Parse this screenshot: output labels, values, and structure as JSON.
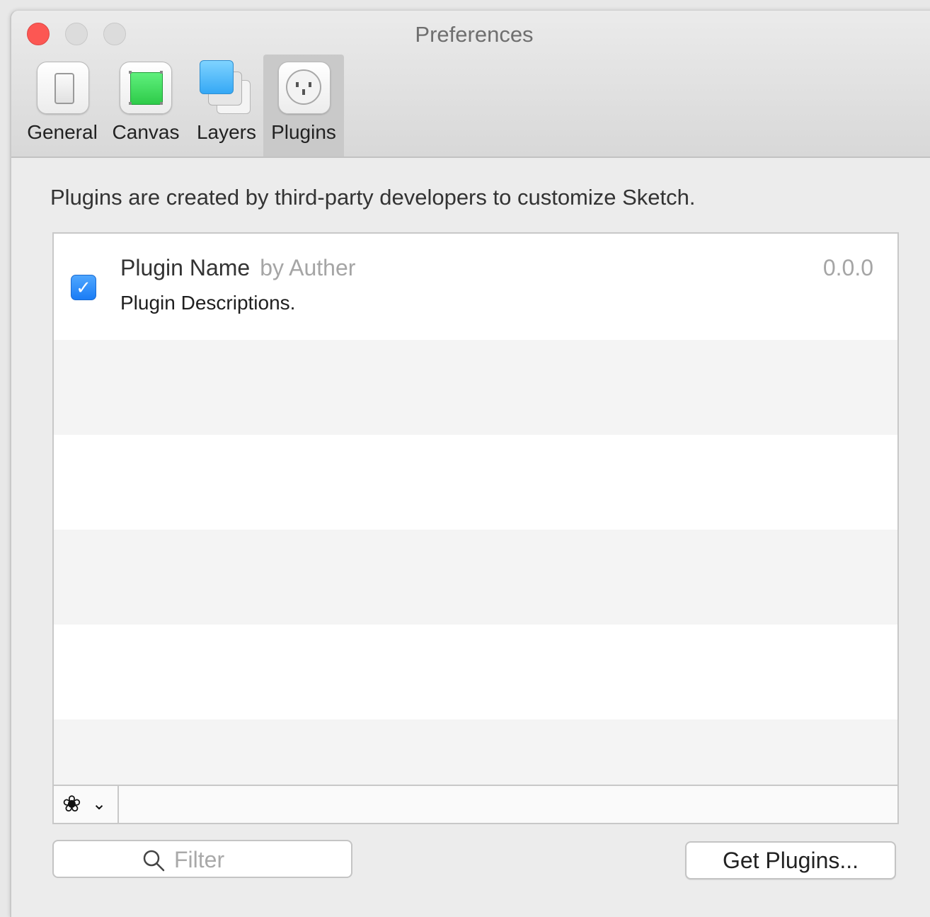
{
  "window": {
    "title": "Preferences"
  },
  "tabs": [
    {
      "label": "General",
      "icon": "general-switch-icon"
    },
    {
      "label": "Canvas",
      "icon": "canvas-square-icon"
    },
    {
      "label": "Layers",
      "icon": "layers-icon"
    },
    {
      "label": "Plugins",
      "icon": "plugin-socket-icon",
      "selected": true
    }
  ],
  "plugins_pane": {
    "intro": "Plugins are created by third-party developers to customize Sketch.",
    "list": [
      {
        "name": "Plugin Name",
        "author": "by Auther",
        "version": "0.0.0",
        "description": "Plugin Descriptions.",
        "enabled": true
      }
    ],
    "filter": {
      "placeholder": "Filter",
      "value": ""
    },
    "get_plugins_label": "Get Plugins..."
  },
  "colors": {
    "close": "#fc5753",
    "checkbox": "#1a7cf5",
    "selected_tab": "#c9c9c9"
  }
}
